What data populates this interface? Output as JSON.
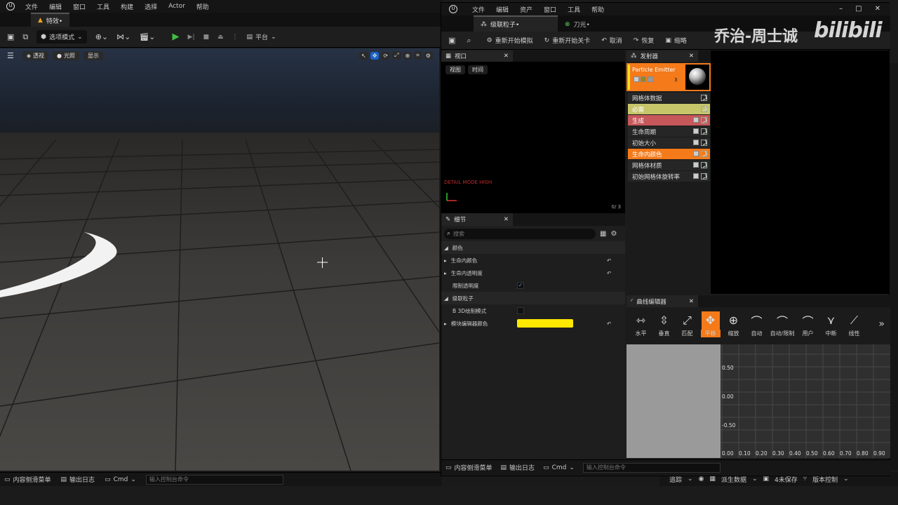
{
  "main": {
    "menu": [
      "文件",
      "编辑",
      "窗口",
      "工具",
      "构建",
      "选择",
      "Actor",
      "帮助"
    ],
    "tab_title": "特效•",
    "toolbar": {
      "mode_label": "选项模式",
      "platform_label": "平台"
    },
    "viewport_buttons": {
      "perspective": "透视",
      "lit": "光照",
      "show": "显示"
    },
    "status": {
      "content_drawer": "内容侧滑菜单",
      "output_log": "输出日志",
      "cmd": "Cmd",
      "console_placeholder": "输入控制台命令"
    },
    "status_right": {
      "trace": "追踪",
      "derived": "派生数据",
      "unsaved": "4未保存",
      "source_control": "版本控制"
    }
  },
  "cascade": {
    "menu": [
      "文件",
      "编辑",
      "资产",
      "窗口",
      "工具",
      "帮助"
    ],
    "tabs": [
      {
        "label": "级联粒子•"
      },
      {
        "label": "刀光•"
      }
    ],
    "toolbar": {
      "restart_sim": "重新开始模拟",
      "restart_level": "重新开始关卡",
      "undo": "取消",
      "redo": "恢复",
      "thumbnail": "缩略"
    },
    "viewport": {
      "tab": "视口",
      "view_btn": "视图",
      "time_btn": "时间",
      "detail_mode": "DETAIL MODE HIGH",
      "counter": "0/ 3"
    },
    "emitters": {
      "tab": "发射器",
      "header_name": "Particle Emitter",
      "header_count": "3",
      "modules": [
        {
          "label": "网格体数据",
          "bg": "#262626",
          "color": "#dddddd",
          "checkbox": false
        },
        {
          "label": "必需",
          "bg": "#c7c56a",
          "color": "#ffffff",
          "checkbox": false
        },
        {
          "label": "生成",
          "bg": "#c6575a",
          "color": "#ffffff",
          "checkbox": true
        },
        {
          "label": "生命周期",
          "bg": "#262626",
          "color": "#dddddd",
          "checkbox": true
        },
        {
          "label": "初始大小",
          "bg": "#262626",
          "color": "#dddddd",
          "checkbox": true
        },
        {
          "label": "生命内颜色",
          "bg": "#f47a1a",
          "color": "#ffffff",
          "checkbox": true
        },
        {
          "label": "网格体材质",
          "bg": "#262626",
          "color": "#dddddd",
          "checkbox": true
        },
        {
          "label": "初始网格体旋转率",
          "bg": "#262626",
          "color": "#dddddd",
          "checkbox": true
        }
      ]
    },
    "details": {
      "tab": "细节",
      "search_placeholder": "搜索",
      "sections": {
        "color": "颜色",
        "cascade": "级联粒子"
      },
      "rows": {
        "color_over_life": "生命内颜色",
        "alpha_over_life": "生命内透明度",
        "clamp_alpha": "限制透明度",
        "b3d": "B 3D绘制模式",
        "module_editor_color": "模块编辑器颜色"
      },
      "module_color": "#ffe800"
    },
    "curve": {
      "tab": "曲线编辑器",
      "buttons": [
        "水平",
        "垂直",
        "匹配",
        "平移",
        "缩放",
        "自动",
        "自动/限制",
        "用户",
        "中断",
        "线性"
      ],
      "y_ticks": [
        "0.50",
        "0.00",
        "-0.50"
      ],
      "x_ticks": [
        "0.00",
        "0.10",
        "0.20",
        "0.30",
        "0.40",
        "0.50",
        "0.60",
        "0.70",
        "0.80",
        "0.90"
      ]
    },
    "status": {
      "content_drawer": "内容侧滑菜单",
      "output_log": "输出日志",
      "cmd": "Cmd",
      "console_placeholder": "输入控制台命令"
    }
  },
  "watermark": {
    "author": "乔治-周士诚",
    "site": "bilibili"
  }
}
